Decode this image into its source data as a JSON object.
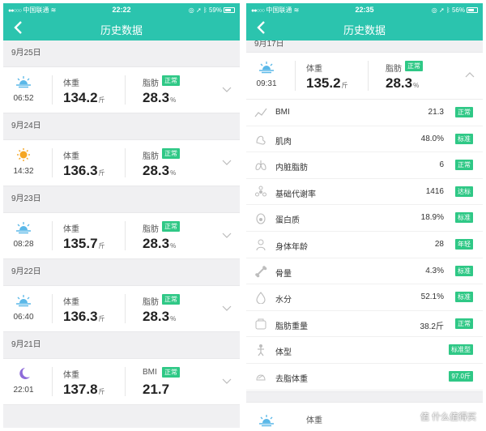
{
  "left": {
    "status": {
      "signal": "●●○○○",
      "carrier": "中国联通",
      "time": "22:22",
      "battery": "59%",
      "battery_level": 0.59
    },
    "title": "历史数据",
    "records": [
      {
        "date": "9月25日",
        "icon": "sunrise-icon",
        "time": "06:52",
        "weight_label": "体重",
        "weight": "134.2",
        "weight_unit": "斤",
        "metric_label": "脂肪",
        "badge": "正常",
        "metric_value": "28.3",
        "metric_unit": "%"
      },
      {
        "date": "9月24日",
        "icon": "sun-icon",
        "time": "14:32",
        "weight_label": "体重",
        "weight": "136.3",
        "weight_unit": "斤",
        "metric_label": "脂肪",
        "badge": "正常",
        "metric_value": "28.3",
        "metric_unit": "%"
      },
      {
        "date": "9月23日",
        "icon": "sunrise-icon",
        "time": "08:28",
        "weight_label": "体重",
        "weight": "135.7",
        "weight_unit": "斤",
        "metric_label": "脂肪",
        "badge": "正常",
        "metric_value": "28.3",
        "metric_unit": "%"
      },
      {
        "date": "9月22日",
        "icon": "sunrise-icon",
        "time": "06:40",
        "weight_label": "体重",
        "weight": "136.3",
        "weight_unit": "斤",
        "metric_label": "脂肪",
        "badge": "正常",
        "metric_value": "28.3",
        "metric_unit": "%"
      },
      {
        "date": "9月21日",
        "icon": "moon-icon",
        "time": "22:01",
        "weight_label": "体重",
        "weight": "137.8",
        "weight_unit": "斤",
        "metric_label": "BMI",
        "badge": "正常",
        "metric_value": "21.7",
        "metric_unit": ""
      }
    ]
  },
  "right": {
    "status": {
      "signal": "●●○○○",
      "carrier": "中国联通",
      "time": "22:35",
      "battery": "56%",
      "battery_level": 0.56
    },
    "title": "历史数据",
    "date": "9月17日",
    "record": {
      "icon": "sunrise-icon",
      "time": "09:31",
      "weight_label": "体重",
      "weight": "135.2",
      "weight_unit": "斤",
      "metric_label": "脂肪",
      "badge": "正常",
      "metric_value": "28.3",
      "metric_unit": "%"
    },
    "metrics": [
      {
        "icon": "bmi-icon",
        "name": "BMI",
        "value": "21.3",
        "badge": "正常"
      },
      {
        "icon": "muscle-icon",
        "name": "肌肉",
        "value": "48.0%",
        "badge": "标准"
      },
      {
        "icon": "lungs-icon",
        "name": "内脏脂肪",
        "value": "6",
        "badge": "正常"
      },
      {
        "icon": "metabolism-icon",
        "name": "基础代谢率",
        "value": "1416",
        "badge": "达标"
      },
      {
        "icon": "egg-icon",
        "name": "蛋白质",
        "value": "18.9%",
        "badge": "标准"
      },
      {
        "icon": "body-age-icon",
        "name": "身体年龄",
        "value": "28",
        "badge": "年轻"
      },
      {
        "icon": "bone-icon",
        "name": "骨量",
        "value": "4.3%",
        "badge": "标准"
      },
      {
        "icon": "water-drop-icon",
        "name": "水分",
        "value": "52.1%",
        "badge": "标准"
      },
      {
        "icon": "fat-weight-icon",
        "name": "脂肪重量",
        "value": "38.2斤",
        "badge": "正常"
      },
      {
        "icon": "body-shape-icon",
        "name": "体型",
        "value": "",
        "badge": "标准型"
      },
      {
        "icon": "lean-mass-icon",
        "name": "去脂体重",
        "value": "",
        "badge": "97.0斤"
      }
    ],
    "next_record": {
      "weight_label": "体重"
    }
  },
  "watermark": "值 什么值得买",
  "colors": {
    "accent": "#2bc4ae",
    "badge": "#2fc886",
    "sun": "#f5a623",
    "sunrise": "#5bb8e8",
    "moon": "#8e6bd9"
  }
}
